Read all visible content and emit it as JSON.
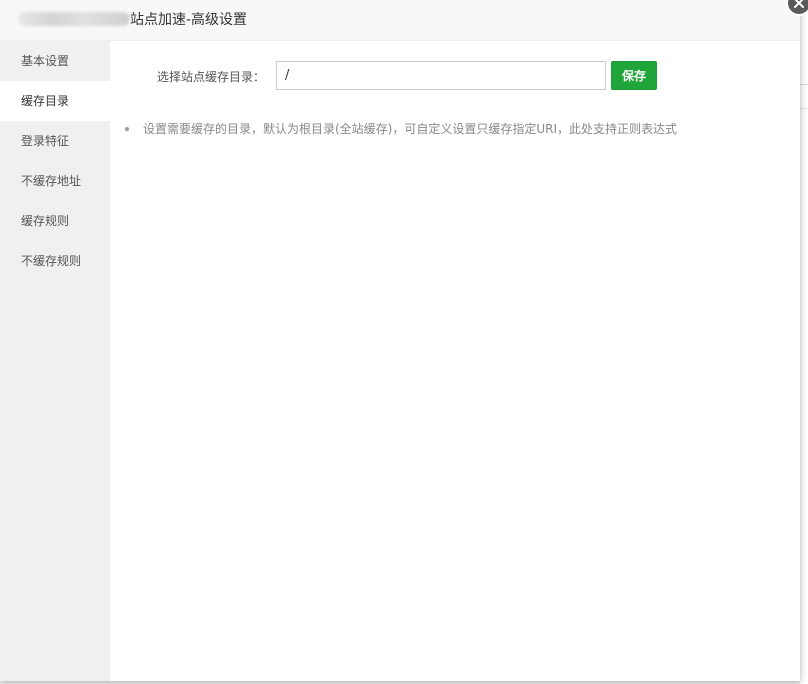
{
  "window": {
    "title": "站点加速-高级设置"
  },
  "sidebar": {
    "items": [
      {
        "label": "基本设置",
        "active": false
      },
      {
        "label": "缓存目录",
        "active": true
      },
      {
        "label": "登录特征",
        "active": false
      },
      {
        "label": "不缓存地址",
        "active": false
      },
      {
        "label": "缓存规则",
        "active": false
      },
      {
        "label": "不缓存规则",
        "active": false
      }
    ]
  },
  "form": {
    "label": "选择站点缓存目录：",
    "value": "/",
    "save_label": "保存"
  },
  "help": {
    "items": [
      "设置需要缓存的目录，默认为根目录(全站缓存)，可自定义设置只缓存指定URI，此处支持正则表达式"
    ]
  },
  "colors": {
    "accent": "#20a53a",
    "sidebar_bg": "#f0f0f0",
    "title_bg": "#f8f8f8"
  },
  "icons": {
    "close": "close-icon"
  }
}
